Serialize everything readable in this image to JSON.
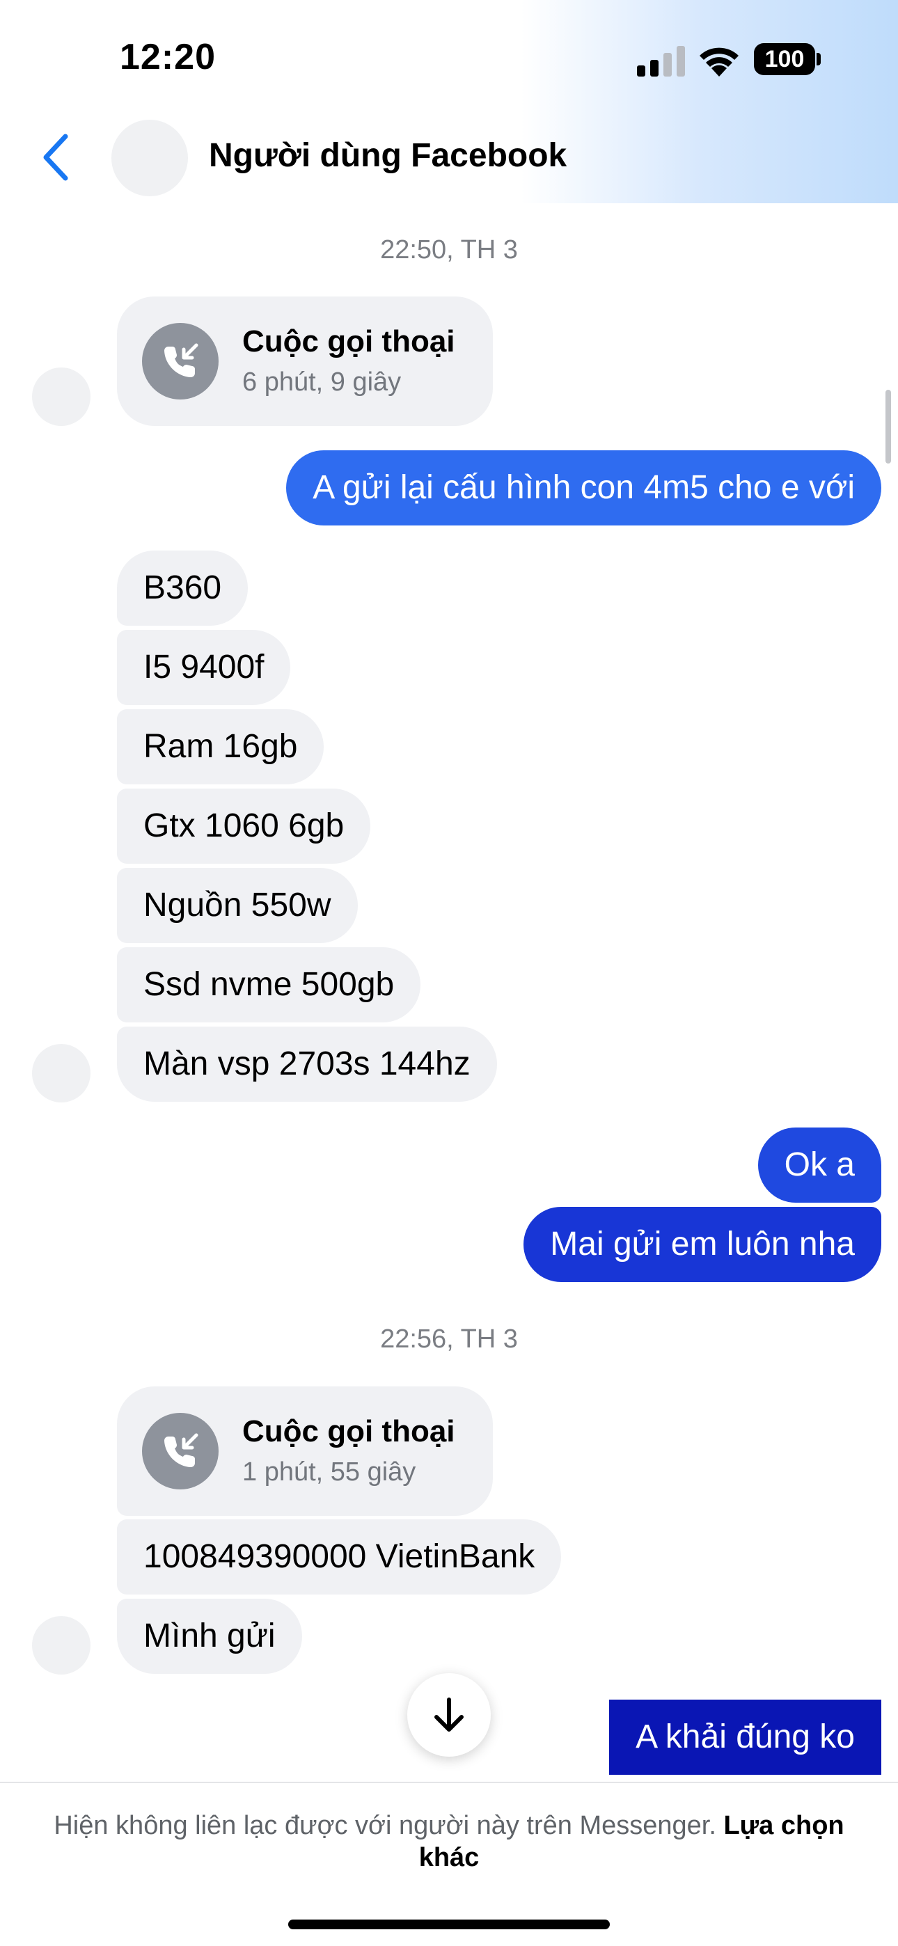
{
  "status_bar": {
    "time": "12:20",
    "battery": "100",
    "icons": [
      "cellular-signal-icon",
      "wifi-icon",
      "battery-icon"
    ]
  },
  "header": {
    "contact_name": "Người dùng Facebook",
    "back_icon": "chevron-left-icon"
  },
  "conversation": {
    "timestamp_1": "22:50, TH 3",
    "call_1": {
      "title": "Cuộc gọi thoại",
      "duration": "6 phút, 9 giây",
      "icon": "incoming-call-icon"
    },
    "out_1": "A gửi lại cấu hình con 4m5 cho e với",
    "specs": [
      "B360",
      "I5 9400f",
      "Ram 16gb",
      "Gtx 1060 6gb",
      "Nguồn 550w",
      "Ssd nvme 500gb",
      "Màn vsp 2703s 144hz"
    ],
    "out_2": "Ok a",
    "out_3": "Mai gửi em luôn nha",
    "timestamp_2": "22:56, TH 3",
    "call_2": {
      "title": "Cuộc gọi thoại",
      "duration": "1 phút, 55 giây",
      "icon": "incoming-call-icon"
    },
    "in_bank": "100849390000 VietinBank",
    "in_send": "Mình gửi",
    "out_4": "A khải đúng ko"
  },
  "colors": {
    "outgoing_top": "#2f6cf0",
    "outgoing_mid": "#1d38d8",
    "outgoing_bottom": "#0a16b4",
    "incoming": "#f0f1f4",
    "accent": "#1877f2"
  },
  "footer": {
    "notice": "Hiện không liên lạc được với người này trên Messenger.",
    "link": "Lựa chọn khác"
  }
}
